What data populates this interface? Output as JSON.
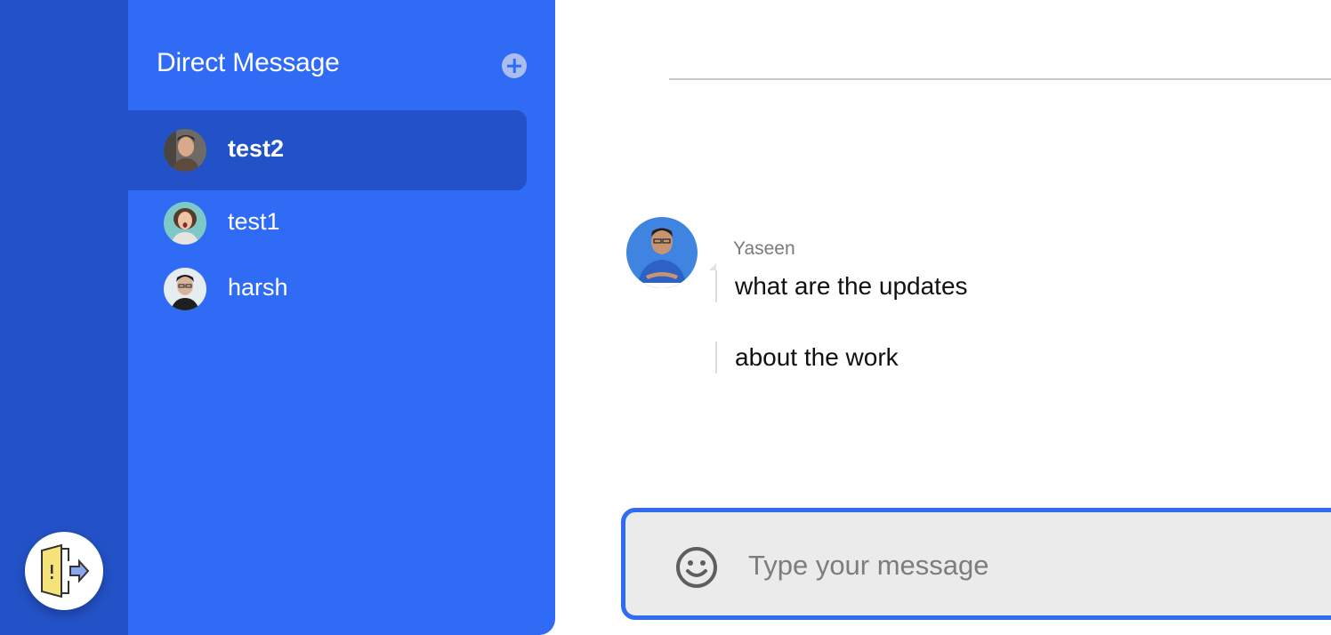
{
  "sidebar": {
    "logout_icon": "door-exit-icon"
  },
  "dm_panel": {
    "title": "Direct Message",
    "add_icon": "plus-circle-icon",
    "contacts": [
      {
        "name": "test2",
        "active": true
      },
      {
        "name": "test1",
        "active": false
      },
      {
        "name": "harsh",
        "active": false
      }
    ]
  },
  "chat": {
    "sender": "Yaseen",
    "messages": [
      {
        "text": "what are the updates"
      },
      {
        "text": "about the work"
      }
    ],
    "composer": {
      "placeholder": "Type your message",
      "value": "",
      "emoji_icon": "smiley-icon"
    }
  },
  "colors": {
    "rail": "#2352c8",
    "panel": "#2f6bf5",
    "active_item": "#2352c8",
    "composer_border": "#2f6bf5"
  }
}
